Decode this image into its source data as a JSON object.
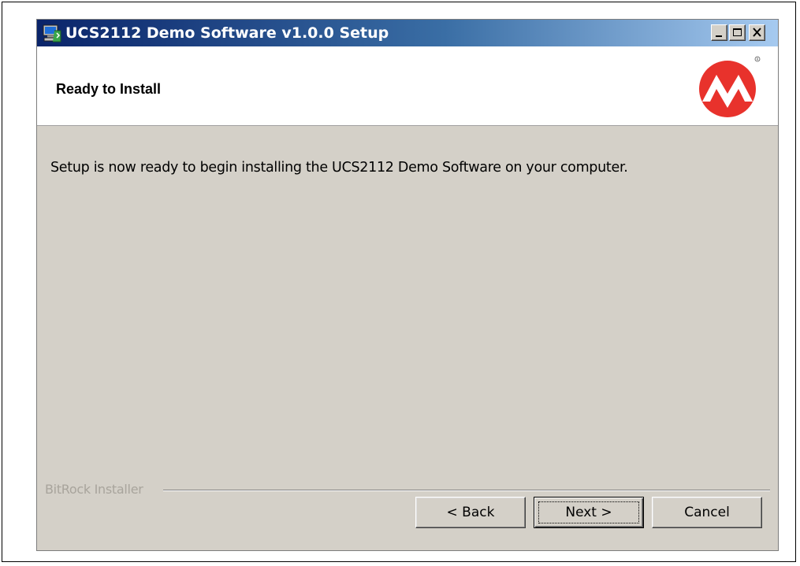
{
  "window": {
    "title": "UCS2112 Demo Software v1.0.0 Setup",
    "app_icon": "computer-install-icon"
  },
  "titlebar_buttons": {
    "minimize": "minimize-icon",
    "maximize": "maximize-icon",
    "close": "close-icon"
  },
  "header": {
    "title": "Ready to Install",
    "logo": "microchip-logo"
  },
  "body": {
    "message": "Setup is now ready to begin installing the UCS2112 Demo Software on your computer."
  },
  "footer": {
    "group_label": "BitRock Installer",
    "back_label": "< Back",
    "next_label": "Next >",
    "cancel_label": "Cancel"
  },
  "colors": {
    "titlebar_start": "#0a246a",
    "titlebar_end": "#a6caf0",
    "dialog_bg": "#d4d0c8",
    "logo_red": "#e8322c"
  }
}
